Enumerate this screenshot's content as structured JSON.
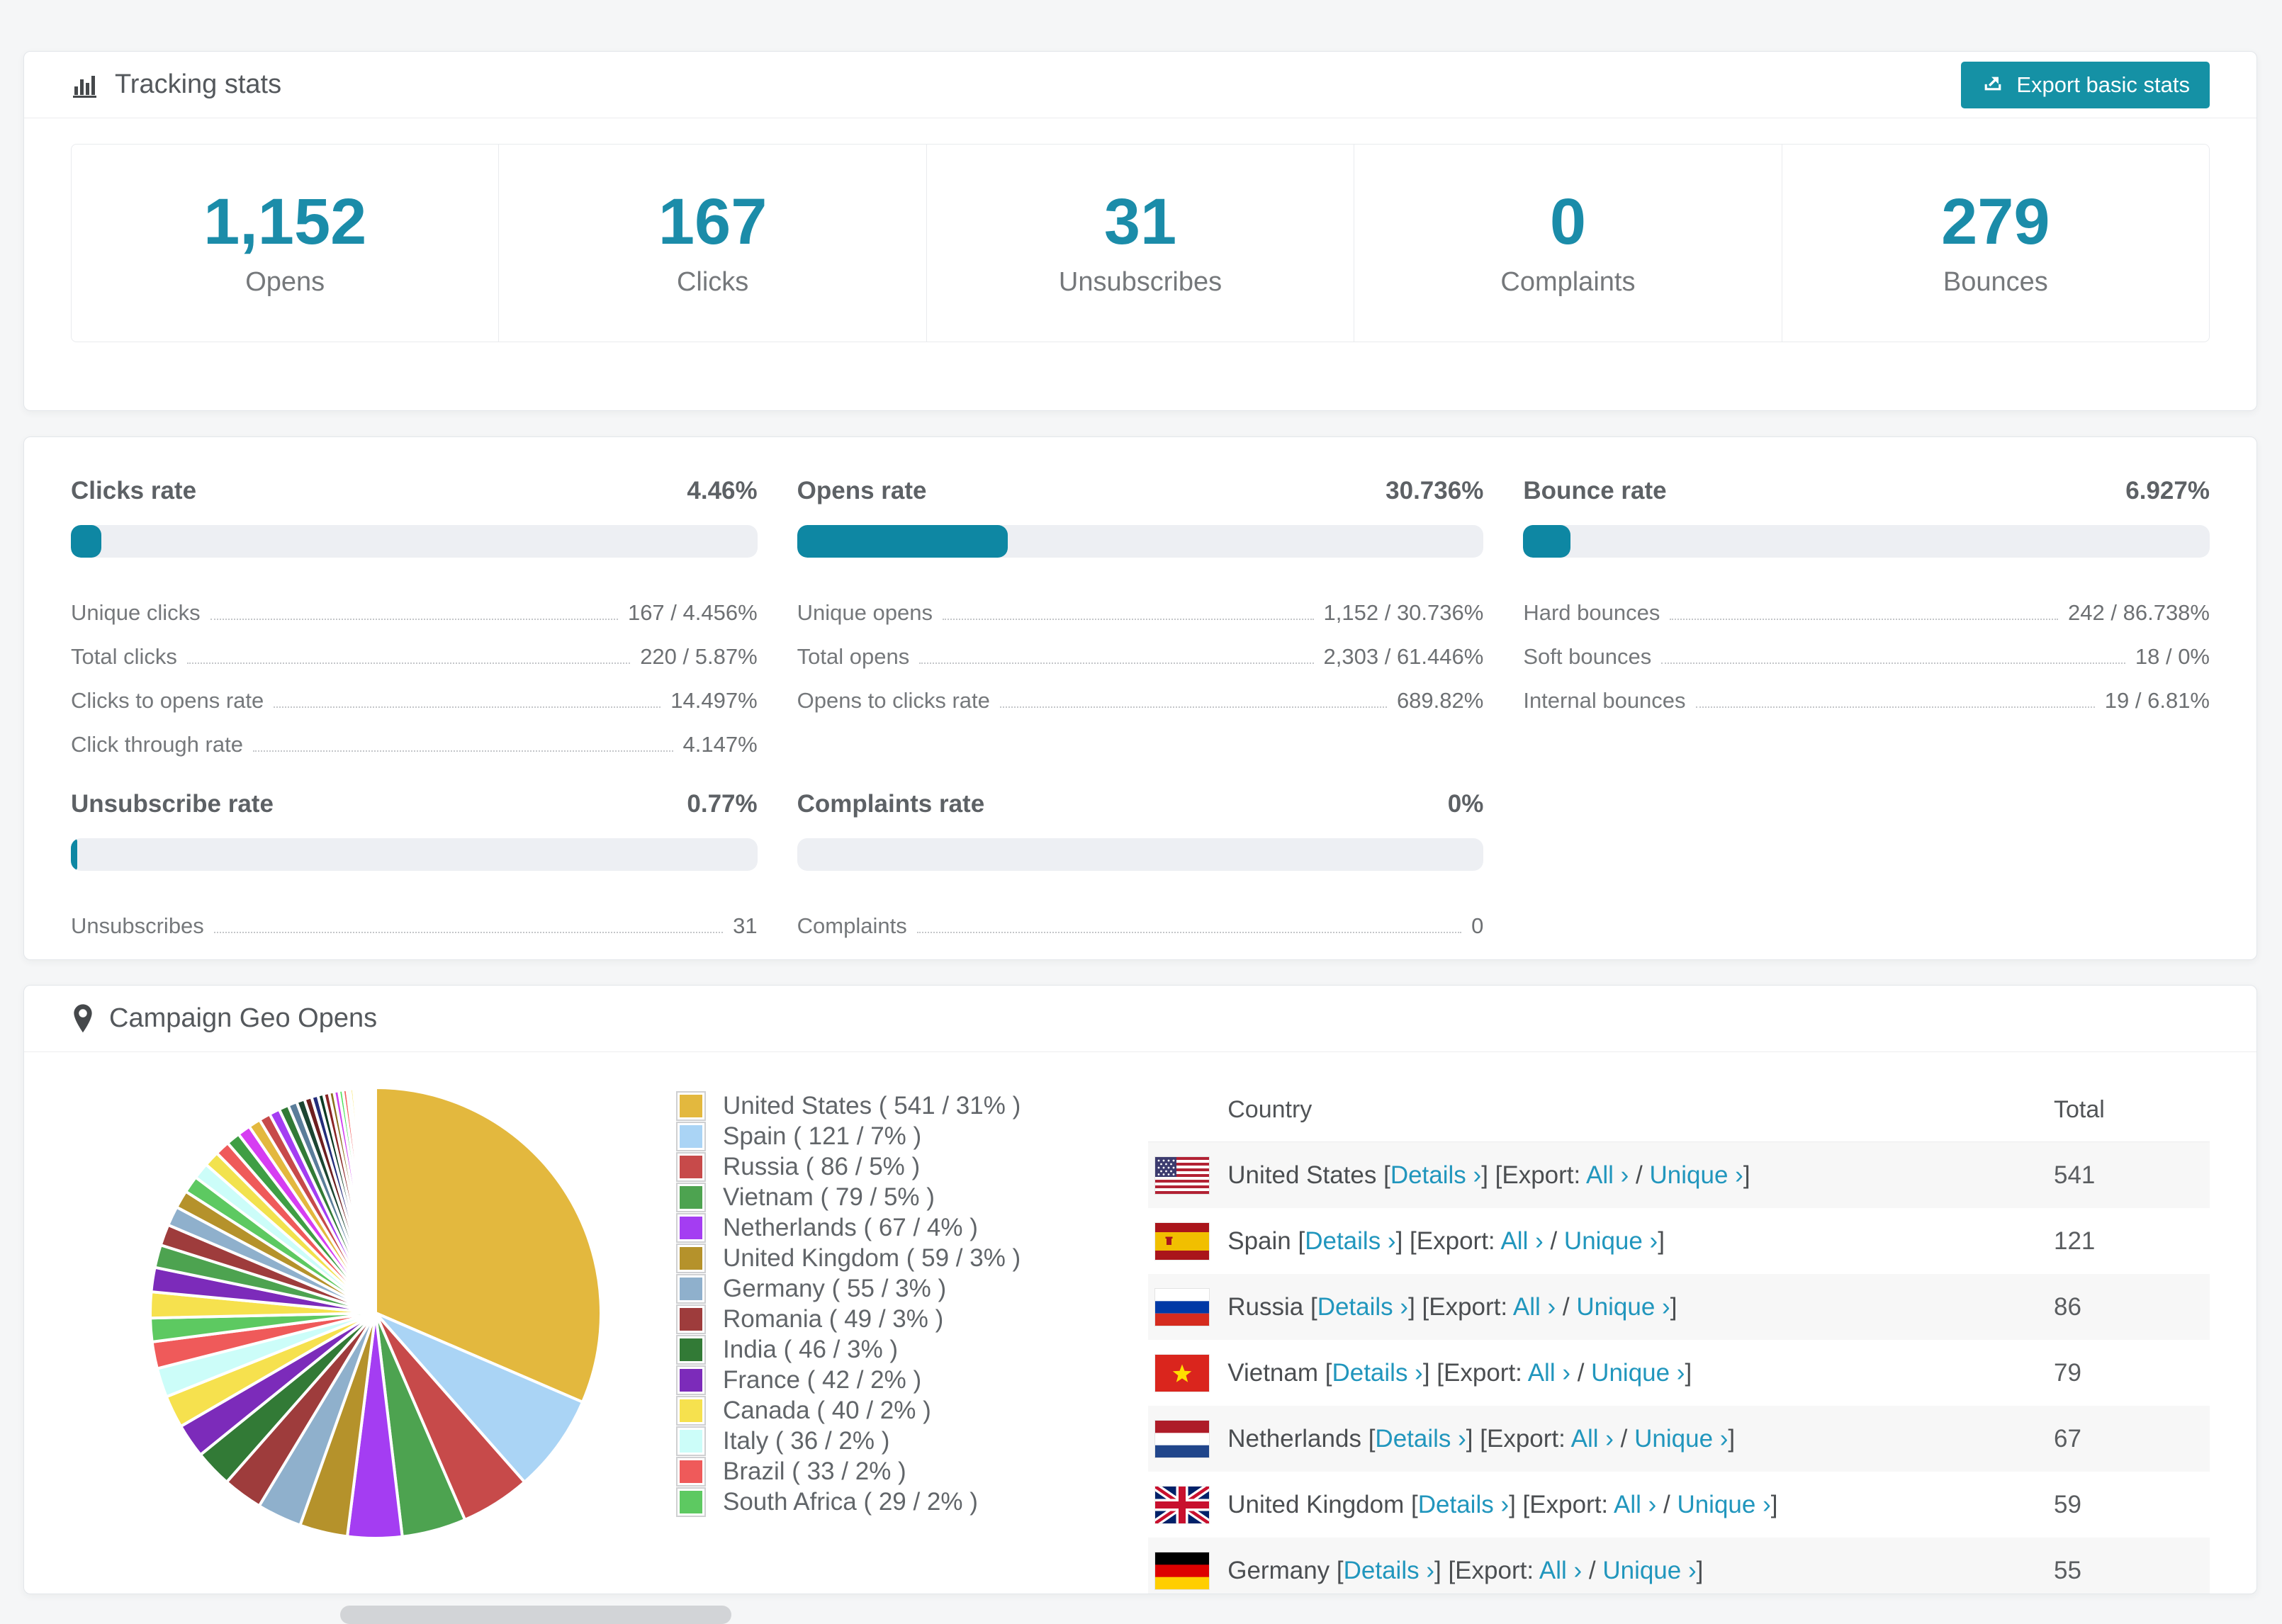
{
  "colors": {
    "accent_teal": "#1591a5",
    "stat_number": "#1b8ca9",
    "bar_fill": "#0e87a3",
    "bar_track": "#edeff3",
    "link": "#2196bd",
    "row_stripe": "#f7f7f7"
  },
  "tracking": {
    "title": "Tracking stats",
    "export_button": "Export basic stats",
    "stats": [
      {
        "value": "1,152",
        "label": "Opens"
      },
      {
        "value": "167",
        "label": "Clicks"
      },
      {
        "value": "31",
        "label": "Unsubscribes"
      },
      {
        "value": "0",
        "label": "Complaints"
      },
      {
        "value": "279",
        "label": "Bounces"
      }
    ]
  },
  "rates": [
    {
      "title": "Clicks rate",
      "value": "4.46%",
      "percent": 4.46,
      "rows": [
        {
          "label": "Unique clicks",
          "value": "167 / 4.456%"
        },
        {
          "label": "Total clicks",
          "value": "220 / 5.87%"
        },
        {
          "label": "Clicks to opens rate",
          "value": "14.497%"
        },
        {
          "label": "Click through rate",
          "value": "4.147%"
        }
      ]
    },
    {
      "title": "Opens rate",
      "value": "30.736%",
      "percent": 30.736,
      "rows": [
        {
          "label": "Unique opens",
          "value": "1,152 / 30.736%"
        },
        {
          "label": "Total opens",
          "value": "2,303 / 61.446%"
        },
        {
          "label": "Opens to clicks rate",
          "value": "689.82%"
        }
      ]
    },
    {
      "title": "Bounce rate",
      "value": "6.927%",
      "percent": 6.927,
      "rows": [
        {
          "label": "Hard bounces",
          "value": "242 / 86.738%"
        },
        {
          "label": "Soft bounces",
          "value": "18 / 0%"
        },
        {
          "label": "Internal bounces",
          "value": "19 / 6.81%"
        }
      ]
    },
    {
      "title": "Unsubscribe rate",
      "value": "0.77%",
      "percent": 0.77,
      "rows": [
        {
          "label": "Unsubscribes",
          "value": "31"
        }
      ]
    },
    {
      "title": "Complaints rate",
      "value": "0%",
      "percent": 0,
      "rows": [
        {
          "label": "Complaints",
          "value": "0"
        }
      ]
    }
  ],
  "geo": {
    "title": "Campaign Geo Opens",
    "columns": {
      "country": "Country",
      "total": "Total"
    },
    "links": {
      "details": "Details ›",
      "export_prefix": "Export:",
      "all": "All ›",
      "separator": "/",
      "unique": "Unique ›"
    },
    "rows": [
      {
        "country": "United States",
        "flag": "us",
        "total": "541"
      },
      {
        "country": "Spain",
        "flag": "es",
        "total": "121"
      },
      {
        "country": "Russia",
        "flag": "ru",
        "total": "86"
      },
      {
        "country": "Vietnam",
        "flag": "vn",
        "total": "79"
      },
      {
        "country": "Netherlands",
        "flag": "nl",
        "total": "67"
      },
      {
        "country": "United Kingdom",
        "flag": "gb",
        "total": "59"
      },
      {
        "country": "Germany",
        "flag": "de",
        "total": "55",
        "partial": true
      }
    ]
  },
  "chart_data": {
    "type": "pie",
    "title": "Campaign Geo Opens",
    "legend_position": "right",
    "start_angle_deg": 0,
    "direction": "clockwise",
    "slices": [
      {
        "label": "United States",
        "value": 541,
        "percent": 31,
        "color": "#e3b83e",
        "legend": "United States ( 541 / 31% )"
      },
      {
        "label": "Spain",
        "value": 121,
        "percent": 7,
        "color": "#aad4f5",
        "legend": "Spain ( 121 / 7% )"
      },
      {
        "label": "Russia",
        "value": 86,
        "percent": 5,
        "color": "#c74a4a",
        "legend": "Russia ( 86 / 5% )"
      },
      {
        "label": "Vietnam",
        "value": 79,
        "percent": 5,
        "color": "#4da350",
        "legend": "Vietnam ( 79 / 5% )"
      },
      {
        "label": "Netherlands",
        "value": 67,
        "percent": 4,
        "color": "#a43df2",
        "legend": "Netherlands ( 67 / 4% )"
      },
      {
        "label": "United Kingdom",
        "value": 59,
        "percent": 3,
        "color": "#b5922b",
        "legend": "United Kingdom ( 59 / 3% )"
      },
      {
        "label": "Germany",
        "value": 55,
        "percent": 3,
        "color": "#8fb0cc",
        "legend": "Germany ( 55 / 3% )"
      },
      {
        "label": "Romania",
        "value": 49,
        "percent": 3,
        "color": "#9e3c3c",
        "legend": "Romania ( 49 / 3% )"
      },
      {
        "label": "India",
        "value": 46,
        "percent": 3,
        "color": "#327a36",
        "legend": "India ( 46 / 3% )"
      },
      {
        "label": "France",
        "value": 42,
        "percent": 2,
        "color": "#7c2bba",
        "legend": "France ( 42 / 2% )"
      },
      {
        "label": "Canada",
        "value": 40,
        "percent": 2,
        "color": "#f6e14e",
        "legend": "Canada ( 40 / 2% )"
      },
      {
        "label": "Italy",
        "value": 36,
        "percent": 2,
        "color": "#ccfdf9",
        "legend": "Italy ( 36 / 2% )"
      },
      {
        "label": "Brazil",
        "value": 33,
        "percent": 2,
        "color": "#ef5a5a",
        "legend": "Brazil ( 33 / 2% )"
      },
      {
        "label": "South Africa",
        "value": 29,
        "percent": 2,
        "color": "#5dc961",
        "legend": "South Africa ( 29 / 2% )"
      }
    ],
    "other_slices": {
      "note": "remaining small unlabeled countries",
      "values": [
        32,
        30,
        28,
        26,
        24,
        22,
        21,
        20,
        19,
        18,
        17,
        16,
        15,
        14,
        13,
        12,
        11,
        10,
        9,
        8,
        7,
        7,
        6,
        6,
        5,
        5,
        4,
        4,
        3,
        3,
        3,
        2,
        2,
        2,
        2,
        2,
        1,
        1,
        1,
        1,
        1,
        1,
        1,
        1
      ],
      "colors": [
        "#f6e14e",
        "#7c2bba",
        "#4da350",
        "#9e3c3c",
        "#8fb0cc",
        "#b5922b",
        "#5dc961",
        "#ccfdf9",
        "#f2e24e",
        "#ef5a5a",
        "#3f9e44",
        "#d63df2",
        "#e3b83e",
        "#c74a4a",
        "#a43df2",
        "#327a36",
        "#5a7d9a",
        "#1c4532",
        "#6e1f1f",
        "#232d7a",
        "#0d3b24",
        "#8a2525",
        "#8a6d1c",
        "#cf3ff0",
        "#4de05a",
        "#f25c5c",
        "#e8fdfc",
        "#f6e14e",
        "#5b21a8",
        "#4da350",
        "#c74a4a",
        "#aad4f5",
        "#e3b83e",
        "#b5922b",
        "#a43df2",
        "#4de05a",
        "#ef5a5a",
        "#d63df2",
        "#aad4f5",
        "#7c2bba",
        "#c74a4a",
        "#4da350",
        "#e3b83e",
        "#9e3c3c"
      ]
    }
  }
}
